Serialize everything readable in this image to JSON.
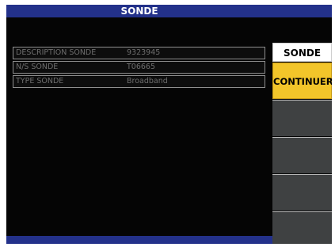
{
  "screen": {
    "title": "SONDE"
  },
  "probe_rows": [
    {
      "label": "DESCRIPTION SONDE",
      "value": "9323945"
    },
    {
      "label": "N/S SONDE",
      "value": "T06665"
    },
    {
      "label": "TYPE SONDE",
      "value": "Broadband"
    }
  ],
  "softkeys": {
    "menu_title": "SONDE",
    "continue_label": "CONTINUER"
  },
  "colors": {
    "title_bar": "#23318a",
    "screen_background": "#050505",
    "active_key": "#f2c52a",
    "inactive_key": "#3f4142"
  }
}
